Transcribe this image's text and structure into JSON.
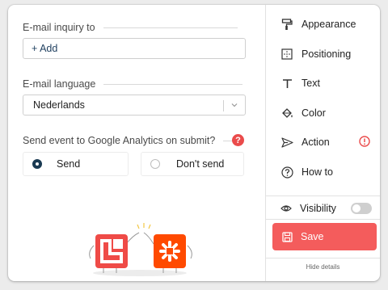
{
  "left": {
    "email_inquiry_label": "E-mail inquiry to",
    "add_label": "+ Add",
    "email_language_label": "E-mail language",
    "language_value": "Nederlands",
    "ga_label": "Send event to Google Analytics on submit?",
    "help_symbol": "?",
    "radio_options": [
      "Send",
      "Don't send"
    ],
    "selected_option": "Send"
  },
  "menu": {
    "items": [
      {
        "label": "Appearance",
        "icon": "paint-roller-icon"
      },
      {
        "label": "Positioning",
        "icon": "positioning-icon"
      },
      {
        "label": "Text",
        "icon": "text-icon"
      },
      {
        "label": "Color",
        "icon": "paint-bucket-icon"
      },
      {
        "label": "Action",
        "icon": "send-icon"
      },
      {
        "label": "How to",
        "icon": "question-circle-icon"
      }
    ],
    "visibility_label": "Visibility",
    "visibility_on": false,
    "save_label": "Save",
    "hide_details_label": "Hide details"
  },
  "colors": {
    "accent_red": "#f45c5c",
    "warning_red": "#ea4b4b",
    "navy": "#1a3a52"
  }
}
